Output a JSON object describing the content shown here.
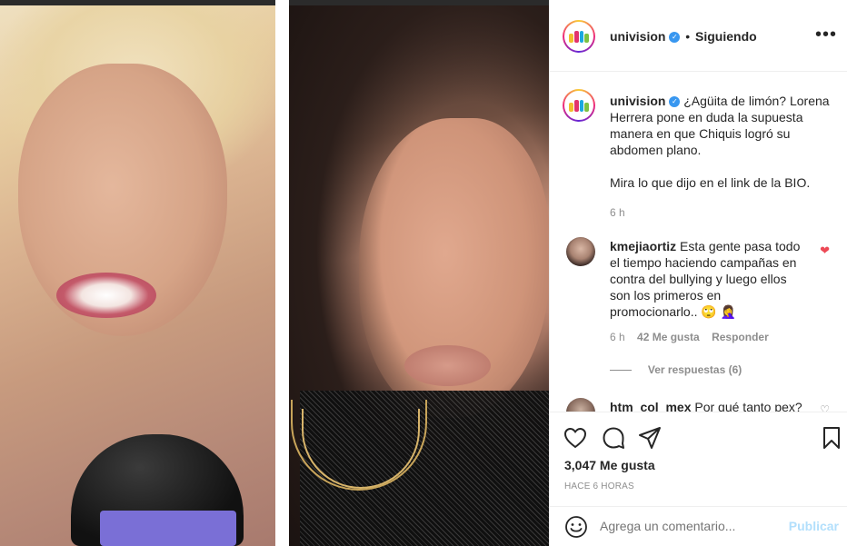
{
  "post": {
    "username": "univision",
    "follow_status": "Siguiendo",
    "more_label": "•••",
    "caption_lines": [
      "¿Agüita de limón? Lorena",
      "Herrera pone en duda la supuesta",
      "manera en que Chiquis logró su",
      "abdomen plano."
    ],
    "caption_line2": "Mira lo que dijo en el link de la BIO.",
    "caption_time": "6 h",
    "likes": "3,047 Me gusta",
    "time_ago": "HACE 6 HORAS"
  },
  "comments": [
    {
      "username": "kmejiaortiz",
      "text_lines": [
        "Esta gente pasa todo",
        "el tiempo haciendo campañas en",
        "contra del bullying y luego ellos",
        "son los primeros en",
        "promocionarlo.. "
      ],
      "emoji_1": "🙄",
      "emoji_2": "🤦‍♀️",
      "time": "6 h",
      "likes": "42 Me gusta",
      "reply": "Responder",
      "view_replies": "Ver respuestas (6)"
    },
    {
      "username": "htm_col_mex",
      "text": "Por qué tanto pex?"
    }
  ],
  "composer": {
    "placeholder": "Agrega un comentario...",
    "publish_label": "Publicar"
  },
  "icons": {
    "brand_colors": [
      "#f2be2c",
      "#e2336c",
      "#1ba8e0",
      "#7cc142"
    ]
  }
}
